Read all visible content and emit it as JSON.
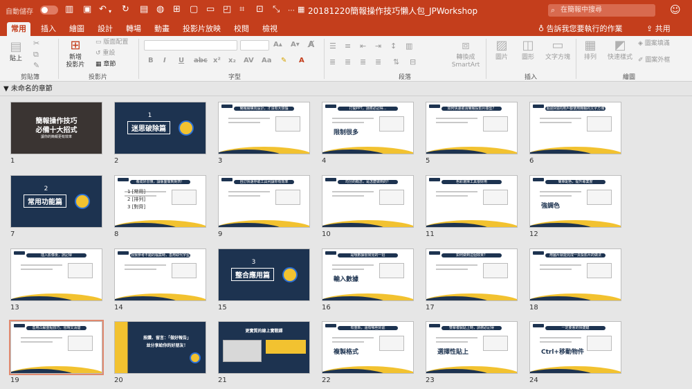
{
  "titlebar": {
    "autosave": "自動儲存",
    "toggle": "關閉",
    "doc_title": "20181220簡報操作技巧懶人包_JPWorkshop",
    "search_placeholder": "在簡報中搜尋"
  },
  "tabs": [
    "常用",
    "插入",
    "繪圖",
    "設計",
    "轉場",
    "動畫",
    "投影片放映",
    "校閱",
    "檢視"
  ],
  "active_tab": "常用",
  "tell_me": "告訴我您要執行的作業",
  "share": "共用",
  "ribbon": {
    "paste": "貼上",
    "clipboard": "剪貼簿",
    "new_slide_1": "新增",
    "new_slide_2": "投影片",
    "layout": "版面配置",
    "reset": "重設",
    "section": "章節",
    "slides_group": "投影片",
    "font_group": "字型",
    "para_group": "段落",
    "convert_1": "轉換成",
    "convert_2": "SmartArt",
    "picture": "圖片",
    "shape": "圖形",
    "textbox": "文字方塊",
    "insert_group": "插入",
    "arrange": "排列",
    "quick_styles": "快速樣式",
    "fill": "圖案填滿",
    "outline": "圖案外框",
    "drawing_group": "繪圖"
  },
  "section_name": "未命名的章節",
  "slides": [
    {
      "n": "1",
      "type": "photo",
      "title": "簡報操作技巧",
      "title2": "必備十大招式",
      "sub": "讓你的簡報更有效率"
    },
    {
      "n": "2",
      "type": "dark-chapter",
      "num": "1",
      "title": "迷思破除篇"
    },
    {
      "n": "3",
      "type": "light",
      "header": "簡報繪橫向設計，才沒有大煩惱"
    },
    {
      "n": "4",
      "type": "light",
      "header": "打開PPT，請務必記得...",
      "big": "限制很多"
    },
    {
      "n": "5",
      "type": "light",
      "header": "如何快速取消簡報投影片樣型？"
    },
    {
      "n": "6",
      "type": "light",
      "header": "超過9成的用戶都使用簡報的文字方塊"
    },
    {
      "n": "7",
      "type": "dark-chapter",
      "num": "2",
      "title": "常用功能篇"
    },
    {
      "n": "8",
      "type": "light",
      "header": "養成好習慣，讓版面做到對齊！",
      "list": [
        "1 [常用]",
        "2 [排列]",
        "3 [對齊]"
      ]
    },
    {
      "n": "9",
      "type": "light",
      "header": "自訂快速存取工具列讓你有效率"
    },
    {
      "n": "10",
      "type": "light",
      "header": "均分的概念，是怎麼做到的？"
    },
    {
      "n": "11",
      "type": "light",
      "header": "色彩選擇工具很好用"
    },
    {
      "n": "12",
      "type": "light",
      "header": "簡單配色，提升專業度",
      "big": "強調色"
    },
    {
      "n": "13",
      "type": "light",
      "header": "插入影像後，請記得"
    },
    {
      "n": "14",
      "type": "light",
      "header": "找我參考不錯的檔案時，善用取代字型"
    },
    {
      "n": "15",
      "type": "dark-chapter",
      "num": "3",
      "title": "整合應用篇"
    },
    {
      "n": "16",
      "type": "light",
      "header": "是哦數據很常見的一招",
      "big": "輸入數據"
    },
    {
      "n": "17",
      "type": "light",
      "header": "如何做到這個效果？"
    },
    {
      "n": "18",
      "type": "light",
      "header": "用圖片就能完成一頁投影片的做法"
    },
    {
      "n": "19",
      "type": "light",
      "header": "善用凸顯重點技巧，省時又清楚"
    },
    {
      "n": "20",
      "type": "promo",
      "title": "按讚、留言：「做好報告」",
      "title2": "並分享給你的好朋友！"
    },
    {
      "n": "21",
      "type": "dark-promo",
      "title": "更實質的線上實戰課"
    },
    {
      "n": "22",
      "type": "light",
      "header": "有重新，還有哪些好處",
      "big": "複製格式"
    },
    {
      "n": "23",
      "type": "light",
      "header": "雙擊複製貼上時，請務必記得",
      "big": "選擇性貼上"
    },
    {
      "n": "24",
      "type": "light",
      "header": "一定要會的快捷鍵",
      "big": "Ctrl+移動物件"
    }
  ]
}
